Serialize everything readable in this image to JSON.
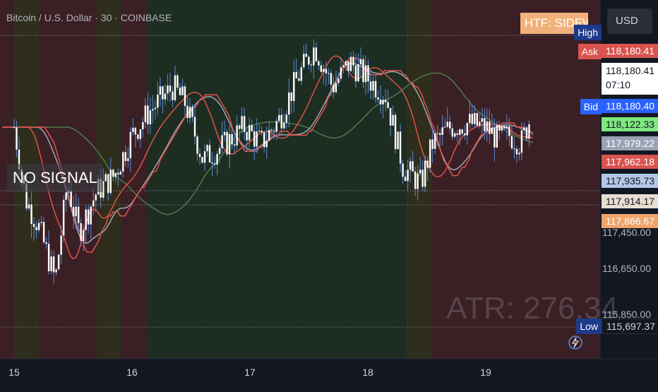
{
  "header": {
    "title": "Bitcoin / U.S. Dollar · 30 · COINBASE",
    "htf_label": "HTF: SIDEWAYS",
    "currency_button": "USD"
  },
  "overlays": {
    "no_signal": "NO SIGNAL",
    "atr": "ATR: 276.34"
  },
  "price_scale": {
    "tags": [
      {
        "key": "high",
        "label": "High",
        "value": "",
        "color": "#1e3a8a"
      },
      {
        "key": "ask",
        "label": "Ask",
        "value": "118,180.41",
        "color": "#d9534f"
      },
      {
        "key": "last",
        "label": "",
        "value": "118,180.41",
        "sub": "07:10",
        "color": "#ffffff"
      },
      {
        "key": "bid",
        "label": "Bid",
        "value": "118,180.40",
        "color": "#2962ff"
      },
      {
        "key": "ma_green",
        "label": "",
        "value": "118,122.33",
        "color": "#7ee87e"
      },
      {
        "key": "ma_gray",
        "label": "",
        "value": "117,979.22",
        "color": "#9aa3b5"
      },
      {
        "key": "ma_red",
        "label": "",
        "value": "117,962.18",
        "color": "#d9534f"
      },
      {
        "key": "ma_lightblue",
        "label": "",
        "value": "117,935.73",
        "color": "#b3c7e6"
      },
      {
        "key": "ma_beige",
        "label": "",
        "value": "117,914.17",
        "color": "#e8ddd0"
      },
      {
        "key": "ma_orange",
        "label": "",
        "value": "117,866.67",
        "color": "#f0a46a"
      },
      {
        "key": "low",
        "label": "Low",
        "value": "115,697.37",
        "color": "#1e3a8a"
      }
    ],
    "ticks": [
      "116,650.00",
      "115,850.00"
    ],
    "partial_tick": "117,450.00"
  },
  "time_axis": {
    "labels": [
      "15",
      "16",
      "17",
      "18",
      "19"
    ]
  },
  "chart_data": {
    "type": "candlestick",
    "symbol": "Bitcoin / U.S. Dollar",
    "interval": "30",
    "exchange": "COINBASE",
    "y_range": [
      115450,
      118950
    ],
    "x_categories": [
      "15",
      "16",
      "17",
      "18",
      "19"
    ],
    "close_path": [
      [
        15.0,
        117.9
      ],
      [
        15.1,
        117.0
      ],
      [
        15.2,
        116.7
      ],
      [
        15.35,
        116.0
      ],
      [
        15.45,
        117.2
      ],
      [
        15.55,
        116.6
      ],
      [
        15.7,
        117.1
      ],
      [
        15.85,
        117.3
      ],
      [
        16.0,
        117.8
      ],
      [
        16.15,
        118.1
      ],
      [
        16.35,
        118.4
      ],
      [
        16.45,
        118.2
      ],
      [
        16.6,
        117.5
      ],
      [
        16.8,
        117.7
      ],
      [
        16.95,
        117.9
      ],
      [
        17.1,
        117.7
      ],
      [
        17.25,
        118.0
      ],
      [
        17.4,
        118.5
      ],
      [
        17.55,
        118.9
      ],
      [
        17.7,
        118.4
      ],
      [
        17.85,
        118.7
      ],
      [
        18.0,
        118.5
      ],
      [
        18.15,
        118.3
      ],
      [
        18.3,
        117.4
      ],
      [
        18.45,
        117.2
      ],
      [
        18.55,
        117.7
      ],
      [
        18.7,
        117.9
      ],
      [
        18.85,
        117.95
      ],
      [
        19.0,
        117.9
      ],
      [
        19.1,
        117.75
      ],
      [
        19.2,
        117.8
      ],
      [
        19.3,
        117.7
      ],
      [
        19.4,
        118.1
      ]
    ],
    "ma_red": "step-like moving average",
    "ma_gray": "smooth moving average",
    "ma_green": "slow moving average",
    "atr": 276.34,
    "last_price": 118180.41,
    "low": 115697.37,
    "signal": "NO SIGNAL",
    "htf": "SIDEWAYS"
  },
  "colors": {
    "background": "#131722",
    "candle": "#ffffff",
    "wick_blue": "#5b8bd6",
    "ma_red": "#e0524a",
    "ma_gray": "#a0a6b2",
    "ma_green": "#4e7b4a",
    "zone_red": "#3a1f24",
    "zone_yellow": "#2f2d1c",
    "zone_green": "#1d2d22"
  }
}
